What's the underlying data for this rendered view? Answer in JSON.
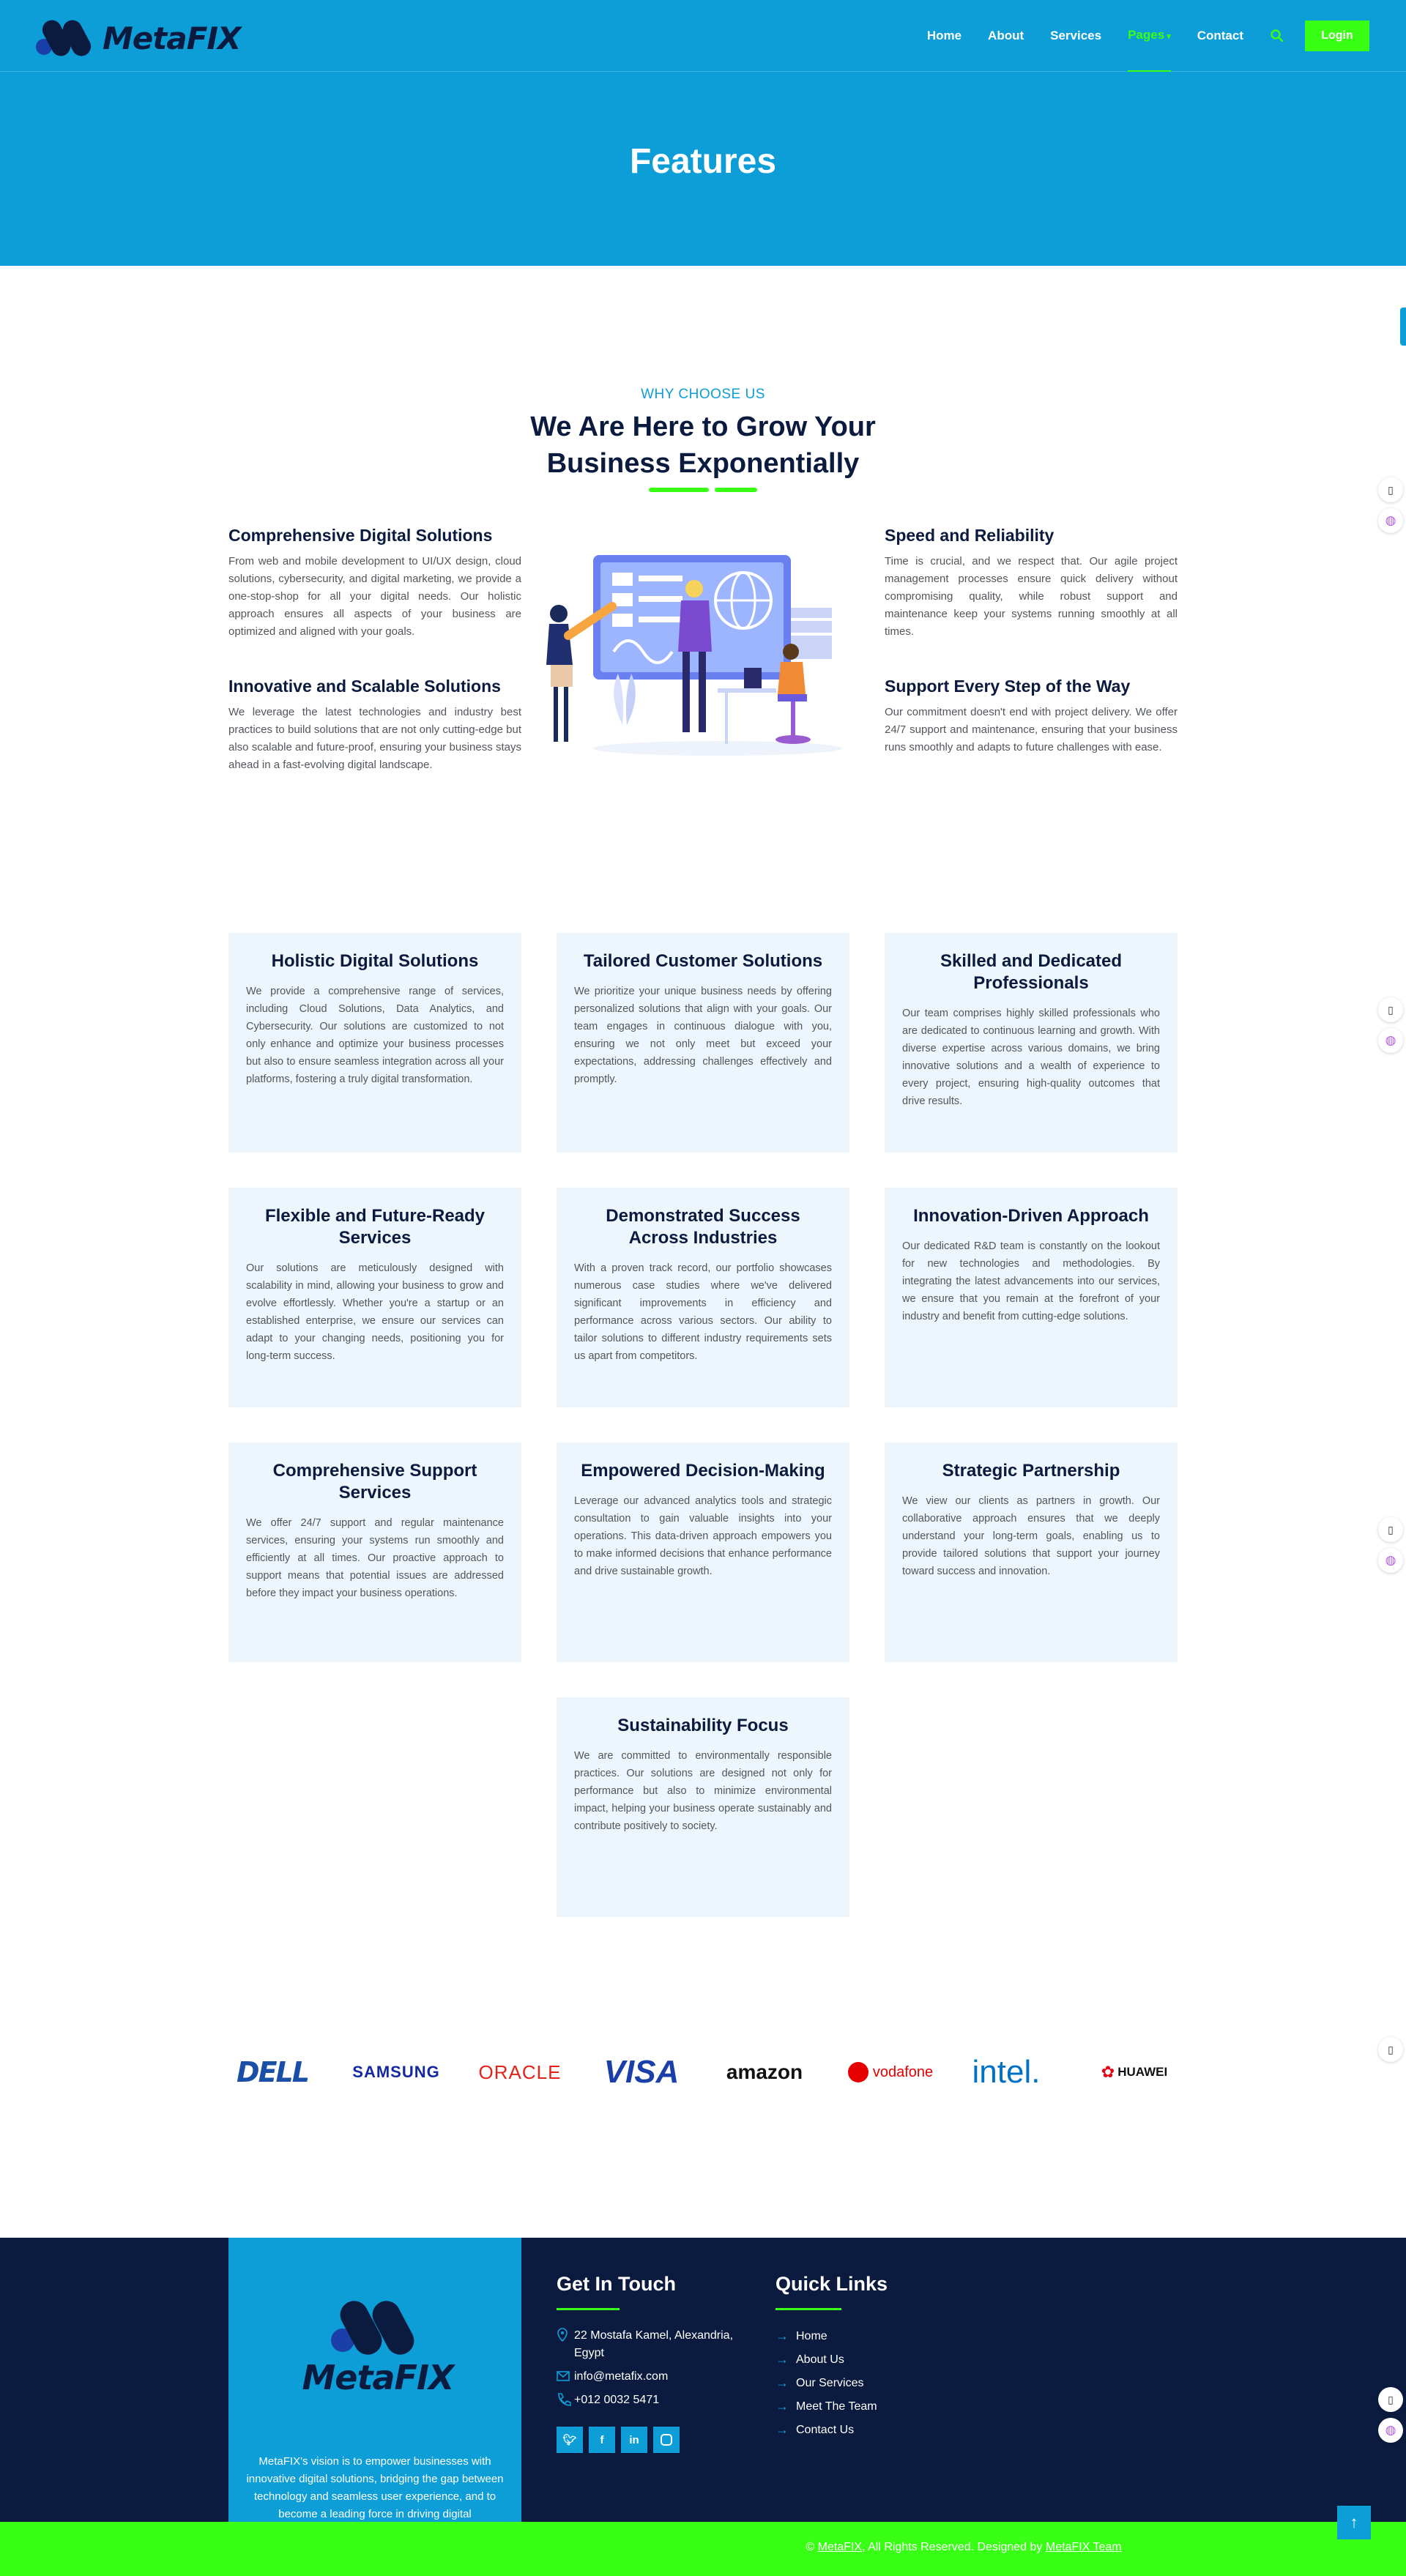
{
  "header": {
    "logo_text": "MetaFIX",
    "nav": [
      "Home",
      "About",
      "Services",
      "Pages",
      "Contact"
    ],
    "active_nav": "Pages",
    "login_label": "Login"
  },
  "hero": {
    "title": "Features"
  },
  "why": {
    "eyebrow": "WHY CHOOSE US",
    "title": "We Are Here to Grow Your Business Exponentially",
    "features": [
      {
        "title": "Comprehensive Digital Solutions",
        "text": "From web and mobile development to UI/UX design, cloud solutions, cybersecurity, and digital marketing, we provide a one-stop-shop for all your digital needs. Our holistic approach ensures all aspects of your business are optimized and aligned with your goals."
      },
      {
        "title": "Innovative and Scalable Solutions",
        "text": "We leverage the latest technologies and industry best practices to build solutions that are not only cutting-edge but also scalable and future-proof, ensuring your business stays ahead in a fast-evolving digital landscape."
      },
      {
        "title": "Speed and Reliability",
        "text": "Time is crucial, and we respect that. Our agile project management processes ensure quick delivery without compromising quality, while robust support and maintenance keep your systems running smoothly at all times."
      },
      {
        "title": "Support Every Step of the Way",
        "text": "Our commitment doesn't end with project delivery. We offer 24/7 support and maintenance, ensuring that your business runs smoothly and adapts to future challenges with ease."
      }
    ]
  },
  "cards": [
    {
      "title": "Holistic Digital Solutions",
      "text": "We provide a comprehensive range of services, including Cloud Solutions, Data Analytics, and Cybersecurity. Our solutions are customized to not only enhance and optimize your business processes but also to ensure seamless integration across all your platforms, fostering a truly digital transformation."
    },
    {
      "title": "Tailored Customer Solutions",
      "text": "We prioritize your unique business needs by offering personalized solutions that align with your goals. Our team engages in continuous dialogue with you, ensuring we not only meet but exceed your expectations, addressing challenges effectively and promptly."
    },
    {
      "title": "Skilled and Dedicated Professionals",
      "text": "Our team comprises highly skilled professionals who are dedicated to continuous learning and growth. With diverse expertise across various domains, we bring innovative solutions and a wealth of experience to every project, ensuring high-quality outcomes that drive results."
    },
    {
      "title": "Flexible and Future-Ready Services",
      "text": "Our solutions are meticulously designed with scalability in mind, allowing your business to grow and evolve effortlessly. Whether you're a startup or an established enterprise, we ensure our services can adapt to your changing needs, positioning you for long-term success."
    },
    {
      "title": "Demonstrated Success Across Industries",
      "text": "With a proven track record, our portfolio showcases numerous case studies where we've delivered significant improvements in efficiency and performance across various sectors. Our ability to tailor solutions to different industry requirements sets us apart from competitors."
    },
    {
      "title": "Innovation-Driven Approach",
      "text": "Our dedicated R&D team is constantly on the lookout for new technologies and methodologies. By integrating the latest advancements into our services, we ensure that you remain at the forefront of your industry and benefit from cutting-edge solutions."
    },
    {
      "title": "Comprehensive Support Services",
      "text": "We offer 24/7 support and regular maintenance services, ensuring your systems run smoothly and efficiently at all times. Our proactive approach to support means that potential issues are addressed before they impact your business operations."
    },
    {
      "title": "Empowered Decision-Making",
      "text": "Leverage our advanced analytics tools and strategic consultation to gain valuable insights into your operations. This data-driven approach empowers you to make informed decisions that enhance performance and drive sustainable growth."
    },
    {
      "title": "Strategic Partnership",
      "text": "We view our clients as partners in growth. Our collaborative approach ensures that we deeply understand your long-term goals, enabling us to provide tailored solutions that support your journey toward success and innovation."
    },
    {
      "title": "Sustainability Focus",
      "text": "We are committed to environmentally responsible practices. Our solutions are designed not only for performance but also to minimize environmental impact, helping your business operate sustainably and contribute positively to society."
    }
  ],
  "brands": [
    "DELL",
    "SAMSUNG",
    "ORACLE",
    "VISA",
    "amazon",
    "vodafone",
    "intel.",
    "HUAWEI"
  ],
  "footer": {
    "logo_text": "MetaFIX",
    "vision": "MetaFIX's vision is to empower businesses with innovative digital solutions, bridging the gap between technology and seamless user experience, and to become a leading force in driving digital transformation globally.",
    "contact_title": "Get In Touch",
    "address": "22 Mostafa Kamel, Alexandria, Egypt",
    "email": "info@metafix.com",
    "phone": "+012 0032 5471",
    "links_title": "Quick Links",
    "links": [
      "Home",
      "About Us",
      "Our Services",
      "Meet The Team",
      "Contact Us"
    ],
    "copyright_brand": "MetaFIX",
    "copyright_mid": ", All Rights Reserved. Designed by ",
    "copyright_team": "MetaFIX Team",
    "copyright_prefix": "© "
  },
  "colors": {
    "primary": "#0d9ed8",
    "accent": "#39ff14",
    "dark": "#0b1b3f",
    "card_bg": "#edf6fd"
  },
  "icons": {
    "social": [
      "twitter-icon",
      "facebook-icon",
      "linkedin-icon",
      "instagram-icon"
    ],
    "contact": [
      "map-pin-icon",
      "mail-icon",
      "phone-icon"
    ]
  }
}
